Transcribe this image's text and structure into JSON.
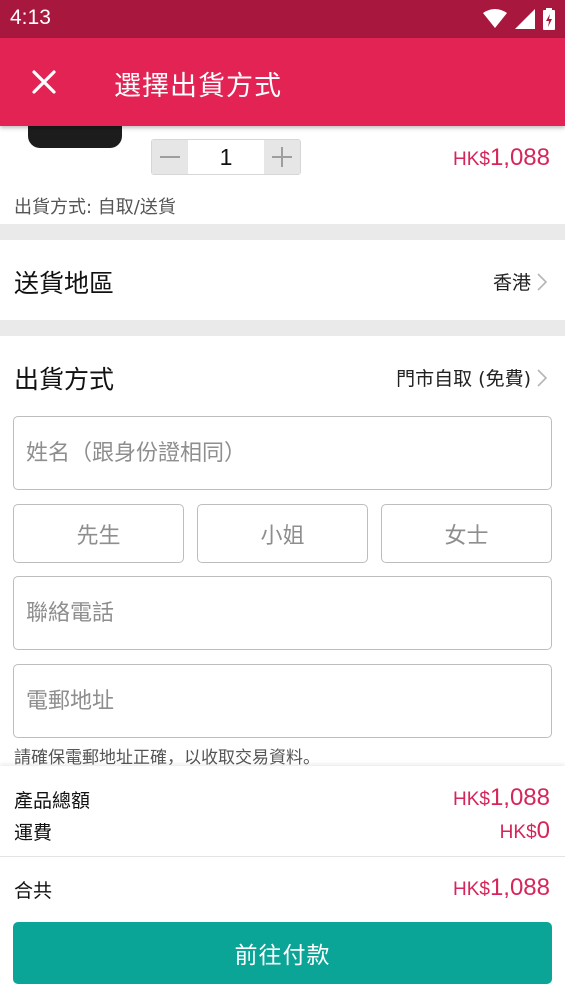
{
  "status_bar": {
    "time": "4:13"
  },
  "app_bar": {
    "title": "選擇出貨方式"
  },
  "product": {
    "quantity": "1",
    "price_currency": "HK$",
    "price_amount": "1,088",
    "shipping_note": "出貨方式: 自取/送貨"
  },
  "delivery_region": {
    "label": "送貨地區",
    "value": "香港"
  },
  "shipping_method": {
    "label": "出貨方式",
    "value": "門市自取 (免費)"
  },
  "form": {
    "name_placeholder": "姓名（跟身份證相同）",
    "titles": [
      "先生",
      "小姐",
      "女士"
    ],
    "phone_placeholder": "聯絡電話",
    "email_placeholder": "電郵地址",
    "email_hint": "請確保電郵地址正確，以收取交易資料。"
  },
  "summary": {
    "subtotal_label": "產品總額",
    "subtotal_currency": "HK$",
    "subtotal_amount": "1,088",
    "shipping_label": "運費",
    "shipping_currency": "HK$",
    "shipping_amount": "0",
    "total_label": "合共",
    "total_currency": "HK$",
    "total_amount": "1,088"
  },
  "pay_button": {
    "label": "前往付款"
  },
  "colors": {
    "accent": "#e22354",
    "status_bar": "#a8183e",
    "price": "#d6255a",
    "pay_button": "#0aa596"
  }
}
